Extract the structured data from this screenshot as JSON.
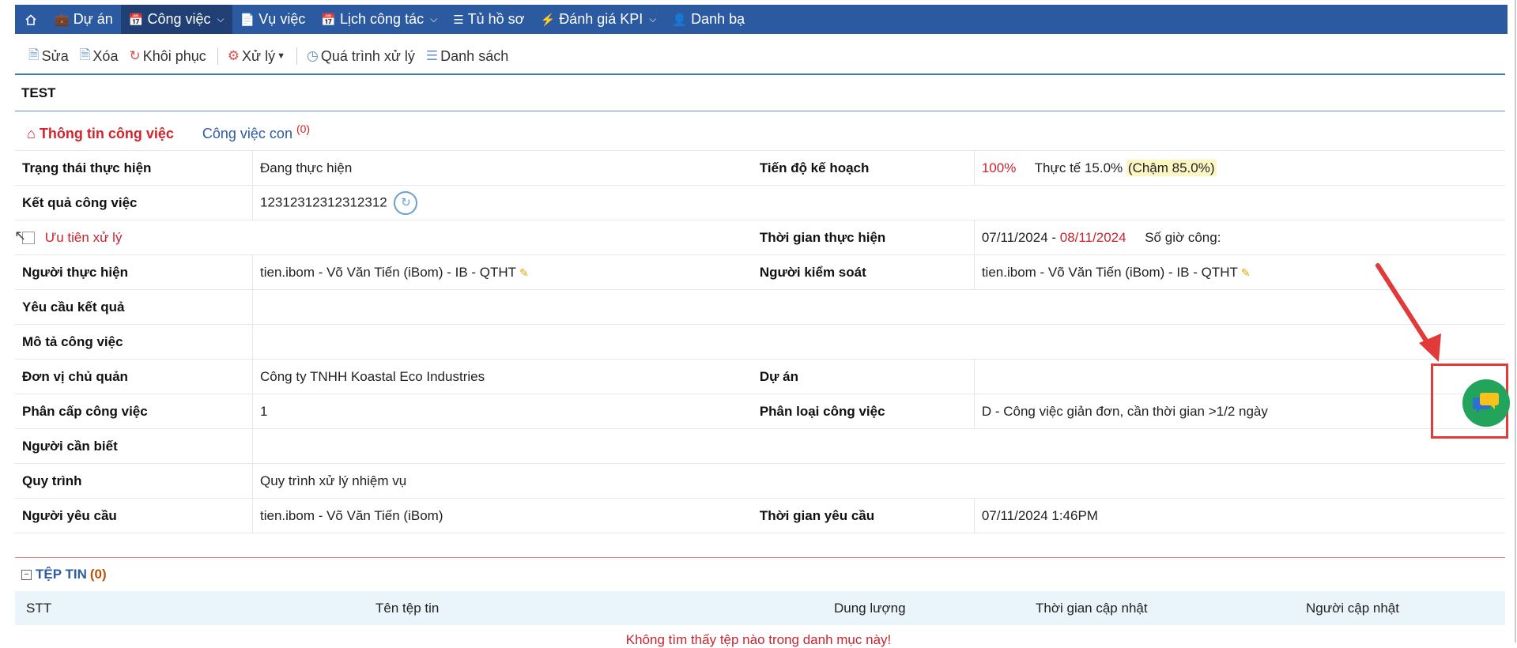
{
  "nav": {
    "items": [
      {
        "label": "Dự án",
        "icon": "briefcase-icon"
      },
      {
        "label": "Công việc",
        "icon": "calendar-icon",
        "active": true,
        "dropdown": true
      },
      {
        "label": "Vụ việc",
        "icon": "file-icon"
      },
      {
        "label": "Lịch công tác",
        "icon": "calendar-icon",
        "dropdown": true
      },
      {
        "label": "Tủ hồ sơ",
        "icon": "layers-icon"
      },
      {
        "label": "Đánh giá KPI",
        "icon": "lightning-icon",
        "dropdown": true
      },
      {
        "label": "Danh bạ",
        "icon": "contact-icon"
      }
    ]
  },
  "toolbar": {
    "edit": "Sửa",
    "delete": "Xóa",
    "restore": "Khôi phục",
    "process": "Xử lý",
    "history": "Quá trình xử lý",
    "list": "Danh sách"
  },
  "title": "TEST",
  "tabs": {
    "info": "Thông tin công việc",
    "sub": "Công việc con",
    "sub_count": "(0)"
  },
  "fields": {
    "status_label": "Trạng thái thực hiện",
    "status_value": "Đang thực hiện",
    "plan_label": "Tiến độ kế hoạch",
    "plan_value": "100%",
    "actual_value": "Thực tế 15.0%",
    "late_value": "(Chậm 85.0%)",
    "result_label": "Kết quả công việc",
    "result_value": "12312312312312312",
    "priority_label": "Ưu tiên xử lý",
    "time_label": "Thời gian thực hiện",
    "time_start": "07/11/2024",
    "time_sep": " - ",
    "time_end": "08/11/2024",
    "hours_label": "Số giờ công:",
    "executor_label": "Người thực hiện",
    "executor_value": "tien.ibom - Võ Văn Tiến (iBom) - IB - QTHT",
    "controller_label": "Người kiểm soát",
    "controller_value": "tien.ibom - Võ Văn Tiến (iBom) - IB - QTHT",
    "requirement_label": "Yêu cầu kết quả",
    "description_label": "Mô tả công việc",
    "unit_label": "Đơn vị chủ quản",
    "unit_value": "Công ty TNHH Koastal Eco Industries",
    "project_label": "Dự án",
    "level_label": "Phân cấp công việc",
    "level_value": "1",
    "category_label": "Phân loại công việc",
    "category_value": "D - Công việc giản đơn, cần thời gian >1/2 ngày",
    "watchers_label": "Người cần biết",
    "process_label": "Quy trình",
    "process_value": "Quy trình xử lý nhiệm vụ",
    "requester_label": "Người yêu cầu",
    "requester_value": "tien.ibom - Võ Văn Tiến (iBom)",
    "request_time_label": "Thời gian yêu cầu",
    "request_time_value": "07/11/2024 1:46PM"
  },
  "files": {
    "title": "TỆP TIN",
    "count": "(0)",
    "columns": [
      "STT",
      "Tên tệp tin",
      "Dung lượng",
      "Thời gian cập nhật",
      "Người cập nhật"
    ],
    "empty": "Không tìm thấy tệp nào trong danh mục này!"
  },
  "colors": {
    "nav_bg": "#2c5aa0",
    "accent_red": "#c72430",
    "link_blue": "#2e5c9e",
    "chat_green": "#22a45d"
  }
}
